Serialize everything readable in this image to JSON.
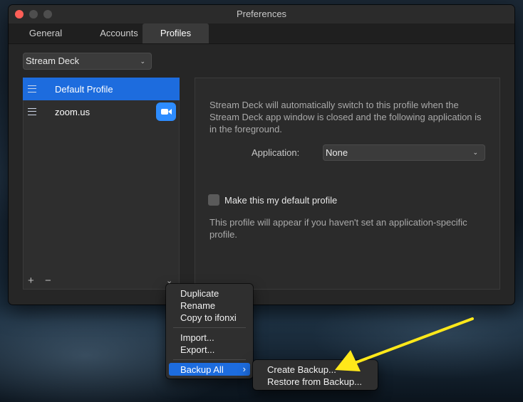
{
  "window": {
    "title": "Preferences",
    "tabs": [
      "General",
      "Accounts",
      "Profiles"
    ]
  },
  "device_select": {
    "value": "Stream Deck"
  },
  "profiles": [
    {
      "name": "Default Profile",
      "selected": true
    },
    {
      "name": "zoom.us",
      "selected": false,
      "app_icon": "zoom-icon"
    }
  ],
  "list_footer": {
    "add": "+",
    "remove": "−",
    "more": "⌄"
  },
  "detail": {
    "description": "Stream Deck will automatically switch to this profile when the Stream Deck app window is closed and the following application is in the foreground.",
    "application_label": "Application:",
    "application_value": "None",
    "default_checkbox_label": "Make this my default profile",
    "default_checkbox_checked": false,
    "hint": "This profile will appear if you haven't set an application-specific profile."
  },
  "context_menu": {
    "items": [
      "Duplicate",
      "Rename",
      "Copy to ifonxi",
      "Import...",
      "Export...",
      "Backup All"
    ],
    "submenu_arrow": "›",
    "submenu": [
      "Create Backup...",
      "Restore from Backup..."
    ]
  },
  "colors": {
    "accent": "#1d6cde",
    "annotation_arrow": "#ffe81a"
  }
}
